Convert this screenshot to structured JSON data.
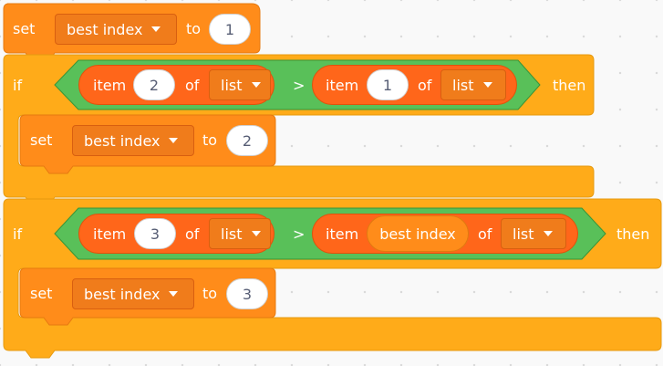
{
  "colors": {
    "variables": "#ff8c1a",
    "variables_dark": "#f07c1b",
    "control": "#ffab19",
    "control_dark": "#e69a10",
    "operators": "#59c059",
    "list": "#ff661a",
    "canvas_bg": "#f9f9f9"
  },
  "block_set_1": {
    "keyword": "set",
    "variable": "best index",
    "to": "to",
    "value": "1"
  },
  "if_1": {
    "keyword": "if",
    "then": "then",
    "operator": ">",
    "left": {
      "item": "item",
      "index": "2",
      "of": "of",
      "list": "list"
    },
    "right": {
      "item": "item",
      "index": "1",
      "of": "of",
      "list": "list"
    },
    "body_set": {
      "keyword": "set",
      "variable": "best index",
      "to": "to",
      "value": "2"
    }
  },
  "if_2": {
    "keyword": "if",
    "then": "then",
    "operator": ">",
    "left": {
      "item": "item",
      "index": "3",
      "of": "of",
      "list": "list"
    },
    "right": {
      "item": "item",
      "index_reporter": "best index",
      "of": "of",
      "list": "list"
    },
    "body_set": {
      "keyword": "set",
      "variable": "best index",
      "to": "to",
      "value": "3"
    }
  }
}
